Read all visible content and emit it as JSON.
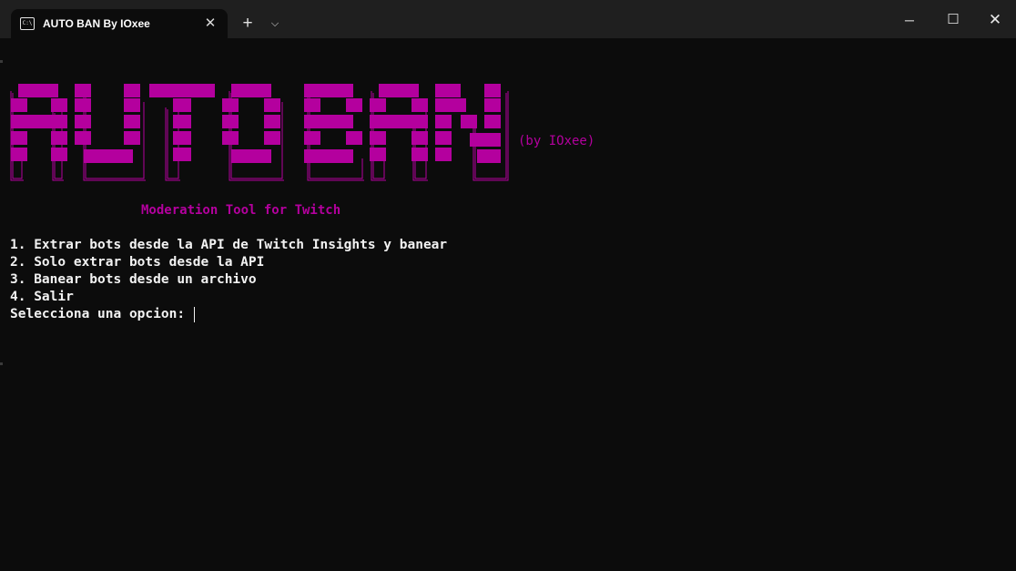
{
  "window": {
    "tab_title": "AUTO BAN By IOxee",
    "tab_icon": "terminal-icon",
    "tab_icon_text": "C:\\"
  },
  "theme": {
    "background": "#0c0c0c",
    "titlebar": "#1f1f1f",
    "accent": "#b4009e",
    "text": "#f2f2f2"
  },
  "banner": {
    "logo_text": "AUTO BAN",
    "byline": "(by IOxee)",
    "subtitle": "Moderation Tool for Twitch"
  },
  "menu": {
    "options": [
      "1. Extrar bots desde la API de Twitch Insights y banear",
      "2. Solo extrar bots desde la API",
      "3. Banear bots desde un archivo",
      "4. Salir"
    ],
    "prompt": "Selecciona una opcion: "
  }
}
